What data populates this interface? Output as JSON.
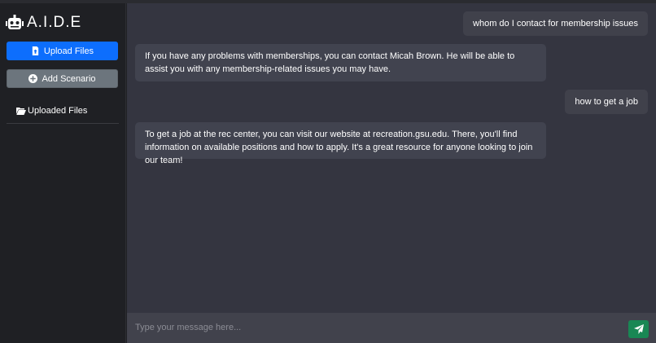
{
  "app": {
    "title": "A.I.D.E"
  },
  "sidebar": {
    "upload_label": "Upload Files",
    "scenario_label": "Add Scenario",
    "uploaded_label": "Uploaded Files"
  },
  "icons": {
    "brand": "robot-icon",
    "upload": "file-upload-icon",
    "scenario": "plus-circle-icon",
    "uploaded": "folder-open-icon",
    "send": "paper-plane-icon"
  },
  "colors": {
    "primary": "#0d6efd",
    "secondary": "#6c757d",
    "success": "#198754",
    "chat_bg": "#343540"
  },
  "messages": [
    {
      "role": "user",
      "text": "whom do I contact for membership issues"
    },
    {
      "role": "bot",
      "text": "If you have any problems with memberships, you can contact Micah Brown. He will be able to assist you with any membership-related issues you may have."
    },
    {
      "role": "user",
      "text": "how to get a job"
    },
    {
      "role": "bot",
      "text": "To get a job at the rec center, you can visit our website at recreation.gsu.edu. There, you'll find information on available positions and how to apply. It's a great resource for anyone looking to join our team!"
    }
  ],
  "composer": {
    "placeholder": "Type your message here..."
  }
}
